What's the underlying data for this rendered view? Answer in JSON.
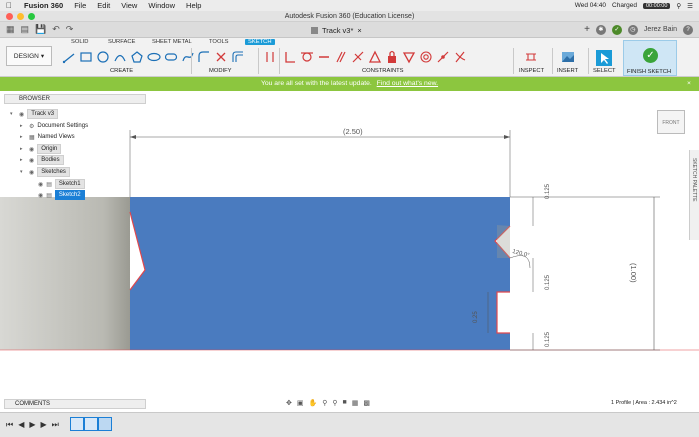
{
  "menubar": {
    "app": "Fusion 360",
    "items": [
      "File",
      "Edit",
      "View",
      "Window",
      "Help"
    ],
    "net": "0 KB/s\n0 KB/s",
    "clock": "Wed 04:40",
    "battery": "Charged",
    "recording": "00:00:00"
  },
  "window": {
    "title": "Autodesk Fusion 360 (Education License)"
  },
  "appbar": {
    "doc_tab": "Track v3*",
    "user": "Jerez Bain"
  },
  "ribbon": {
    "workspace": "DESIGN",
    "tabs": [
      "SOLID",
      "SURFACE",
      "SHEET METAL",
      "TOOLS",
      "SKETCH"
    ],
    "active_tab": "SKETCH",
    "groups": [
      "CREATE",
      "MODIFY",
      "CONSTRAINTS",
      "INSPECT",
      "INSERT",
      "SELECT",
      "FINISH SKETCH"
    ]
  },
  "notice": {
    "text": "You are all set with the latest update.",
    "link": "Find out what's new."
  },
  "browser": {
    "title": "BROWSER",
    "root": "Track v3",
    "nodes": [
      "Document Settings",
      "Named Views",
      "Origin",
      "Bodies",
      "Sketches",
      "Sketch1",
      "Sketch2"
    ]
  },
  "viewcube": {
    "label": "FRONT"
  },
  "sketch_palette": {
    "label": "SKETCH PALETTE"
  },
  "dimensions": {
    "width": "(2.50)",
    "height": "(1.00)",
    "d1": "0.125",
    "d2": "0.125",
    "d3": "0.125",
    "d4": "0.25",
    "angle": "120.0°"
  },
  "comments": {
    "label": "COMMENTS"
  },
  "status": {
    "text": "1 Profile | Area : 2.434 in^2"
  },
  "colors": {
    "accent": "#1b9bd7",
    "notice": "#8cc63f",
    "profile": "#4a7bbf",
    "sketch_line": "#e0484d"
  }
}
